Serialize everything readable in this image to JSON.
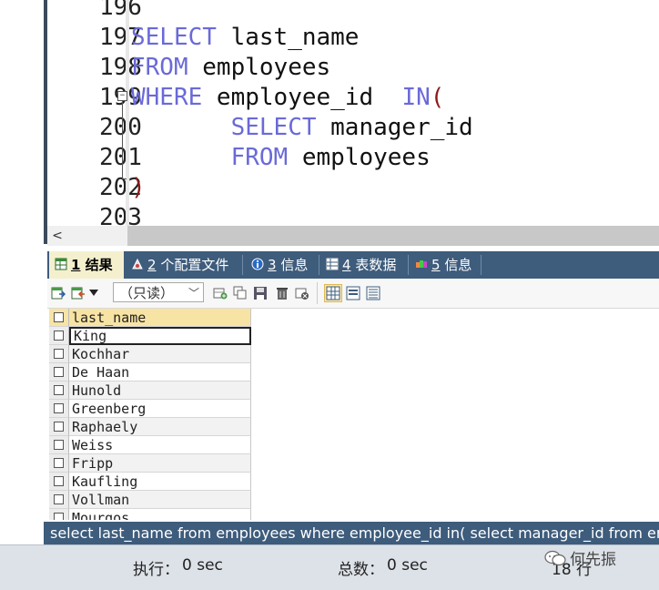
{
  "editor": {
    "line_numbers": [
      "196",
      "197",
      "198",
      "199",
      "200",
      "201",
      "202",
      "203"
    ],
    "lines": [
      {
        "kw": "SELECT",
        "rest": " last_name"
      },
      {
        "kw": "FROM",
        "rest": " employees"
      },
      {
        "kw": "WHERE",
        "rest": " employee_id  ",
        "kw2": "IN",
        "paren": "("
      },
      {
        "indent": "       ",
        "kw": "SELECT",
        "rest": " manager_id"
      },
      {
        "indent": "       ",
        "kw": "FROM",
        "rest": " employees"
      },
      {
        "paren": ")"
      }
    ],
    "fold_marker": "−",
    "colors": {
      "keyword": "#6a6ad8",
      "paren": "#8b1a1a"
    }
  },
  "tabs": [
    {
      "num": "1",
      "label": "结果",
      "icon": "results-grid-icon",
      "active": true
    },
    {
      "num": "2",
      "label": "个配置文件",
      "icon": "profile-icon",
      "active": false
    },
    {
      "num": "3",
      "label": "信息",
      "icon": "info-icon",
      "active": false
    },
    {
      "num": "4",
      "label": "表数据",
      "icon": "table-data-icon",
      "active": false
    },
    {
      "num": "5",
      "label": "信息",
      "icon": "info-colored-icon",
      "active": false
    }
  ],
  "toolbar": {
    "mode_select": "（只读）",
    "icons": [
      "export-icon",
      "import-icon",
      "dropdown-arrow-icon",
      "add-row-icon",
      "duplicate-row-icon",
      "save-icon",
      "delete-icon",
      "discard-icon",
      "grid-view-icon",
      "form-view-icon",
      "text-view-icon"
    ]
  },
  "grid": {
    "column": "last_name",
    "rows": [
      "King",
      "Kochhar",
      "De Haan",
      "Hunold",
      "Greenberg",
      "Raphaely",
      "Weiss",
      "Fripp",
      "Kaufling",
      "Vollman",
      "Mourgos"
    ]
  },
  "sql_line": "select last_name from employees where employee_id in( select manager_id from employees );",
  "status": {
    "exec_label": "执行：",
    "exec_value": "0 sec",
    "total_label": "总数：",
    "total_value": "0 sec",
    "rows_label": "18 行"
  },
  "watermark": "何先振",
  "accent": "#3e5c7c"
}
